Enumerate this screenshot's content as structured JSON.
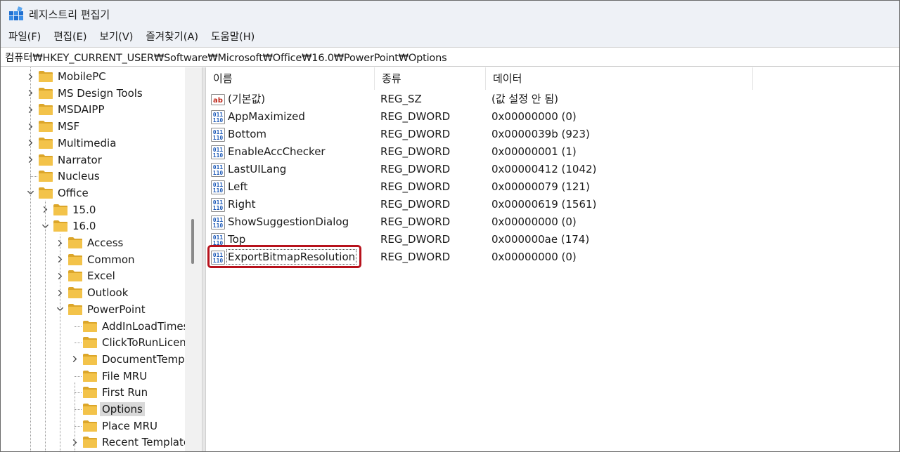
{
  "window": {
    "title": "레지스트리 편집기",
    "app_icon": "registry-editor-icon"
  },
  "menu": [
    "파일(F)",
    "편집(E)",
    "보기(V)",
    "즐겨찾기(A)",
    "도움말(H)"
  ],
  "address": "컴퓨터₩HKEY_CURRENT_USER₩Software₩Microsoft₩Office₩16.0₩PowerPoint₩Options",
  "tree": [
    {
      "label": "MobilePC",
      "depth": 0,
      "expander": "collapsed"
    },
    {
      "label": "MS Design Tools",
      "depth": 0,
      "expander": "collapsed"
    },
    {
      "label": "MSDAIPP",
      "depth": 0,
      "expander": "collapsed"
    },
    {
      "label": "MSF",
      "depth": 0,
      "expander": "collapsed"
    },
    {
      "label": "Multimedia",
      "depth": 0,
      "expander": "collapsed"
    },
    {
      "label": "Narrator",
      "depth": 0,
      "expander": "collapsed"
    },
    {
      "label": "Nucleus",
      "depth": 0,
      "expander": "none"
    },
    {
      "label": "Office",
      "depth": 0,
      "expander": "expanded"
    },
    {
      "label": "15.0",
      "depth": 1,
      "expander": "collapsed"
    },
    {
      "label": "16.0",
      "depth": 1,
      "expander": "expanded"
    },
    {
      "label": "Access",
      "depth": 2,
      "expander": "collapsed"
    },
    {
      "label": "Common",
      "depth": 2,
      "expander": "collapsed"
    },
    {
      "label": "Excel",
      "depth": 2,
      "expander": "collapsed"
    },
    {
      "label": "Outlook",
      "depth": 2,
      "expander": "collapsed"
    },
    {
      "label": "PowerPoint",
      "depth": 2,
      "expander": "expanded"
    },
    {
      "label": "AddInLoadTimes",
      "depth": 3,
      "expander": "none"
    },
    {
      "label": "ClickToRunLicen",
      "depth": 3,
      "expander": "none"
    },
    {
      "label": "DocumentTemp",
      "depth": 3,
      "expander": "collapsed"
    },
    {
      "label": "File MRU",
      "depth": 3,
      "expander": "none"
    },
    {
      "label": "First Run",
      "depth": 3,
      "expander": "none"
    },
    {
      "label": "Options",
      "depth": 3,
      "expander": "none",
      "selected": true
    },
    {
      "label": "Place MRU",
      "depth": 3,
      "expander": "none"
    },
    {
      "label": "Recent Template",
      "depth": 3,
      "expander": "collapsed"
    }
  ],
  "columns": {
    "name": "이름",
    "type": "종류",
    "data": "데이터"
  },
  "values": [
    {
      "name": "(기본값)",
      "type": "REG_SZ",
      "data": "(값 설정 안 됨)",
      "icon": "string-value-icon"
    },
    {
      "name": "AppMaximized",
      "type": "REG_DWORD",
      "data": "0x00000000 (0)",
      "icon": "binary-value-icon"
    },
    {
      "name": "Bottom",
      "type": "REG_DWORD",
      "data": "0x0000039b (923)",
      "icon": "binary-value-icon"
    },
    {
      "name": "EnableAccChecker",
      "type": "REG_DWORD",
      "data": "0x00000001 (1)",
      "icon": "binary-value-icon"
    },
    {
      "name": "LastUILang",
      "type": "REG_DWORD",
      "data": "0x00000412 (1042)",
      "icon": "binary-value-icon"
    },
    {
      "name": "Left",
      "type": "REG_DWORD",
      "data": "0x00000079 (121)",
      "icon": "binary-value-icon"
    },
    {
      "name": "Right",
      "type": "REG_DWORD",
      "data": "0x00000619 (1561)",
      "icon": "binary-value-icon"
    },
    {
      "name": "ShowSuggestionDialog",
      "type": "REG_DWORD",
      "data": "0x00000000 (0)",
      "icon": "binary-value-icon"
    },
    {
      "name": "Top",
      "type": "REG_DWORD",
      "data": "0x000000ae (174)",
      "icon": "binary-value-icon"
    },
    {
      "name": "ExportBitmapResolution",
      "type": "REG_DWORD",
      "data": "0x00000000 (0)",
      "icon": "binary-value-icon",
      "focused": true,
      "highlighted": true
    }
  ],
  "colors": {
    "chrome": "#eef1f6",
    "folder": "#f3c34a",
    "folder_dark": "#dca62a",
    "highlight": "#b7121c",
    "selected": "#d9d9d9"
  }
}
